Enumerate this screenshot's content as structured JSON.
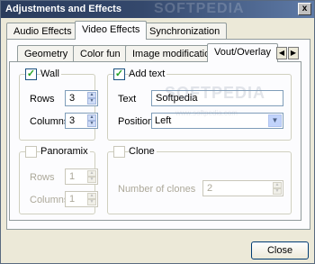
{
  "window": {
    "title": "Adjustments and Effects",
    "close_glyph": "x",
    "watermark": "SOFTPEDIA"
  },
  "outer_tabs": [
    {
      "label": "Audio Effects",
      "active": false
    },
    {
      "label": "Video Effects",
      "active": true
    },
    {
      "label": "Synchronization",
      "active": false
    }
  ],
  "inner_tabs": [
    {
      "label": "Geometry",
      "active": false
    },
    {
      "label": "Color fun",
      "active": false
    },
    {
      "label": "Image modification",
      "active": false
    },
    {
      "label": "Vout/Overlay",
      "active": true
    }
  ],
  "tab_scroll": {
    "left_icon": "◀",
    "right_icon": "▶"
  },
  "wall": {
    "label": "Wall",
    "checked": true,
    "check_glyph": "✓",
    "rows_label": "Rows",
    "rows_value": "3",
    "columns_label": "Columns",
    "columns_value": "3"
  },
  "add_text": {
    "label": "Add text",
    "checked": true,
    "check_glyph": "✓",
    "text_label": "Text",
    "text_value": "Softpedia",
    "position_label": "Position",
    "position_value": "Left",
    "dropdown_icon": "▼"
  },
  "panoramix": {
    "label": "Panoramix",
    "checked": false,
    "rows_label": "Rows",
    "rows_value": "1",
    "columns_label": "Columns",
    "columns_value": "1"
  },
  "clone": {
    "label": "Clone",
    "checked": false,
    "count_label": "Number of clones",
    "count_value": "2"
  },
  "spin_icons": {
    "up": "▲",
    "down": "▼"
  },
  "footer": {
    "close_label": "Close"
  },
  "overlay_watermarks": {
    "big": "SOFTPEDIA",
    "url": "www.softpedia.com"
  },
  "colors": {
    "title_bar": "#2a3c5c",
    "dialog_bg": "#ece9d8",
    "panel_bg": "#fcfcfe",
    "check_mark": "#21a121"
  }
}
